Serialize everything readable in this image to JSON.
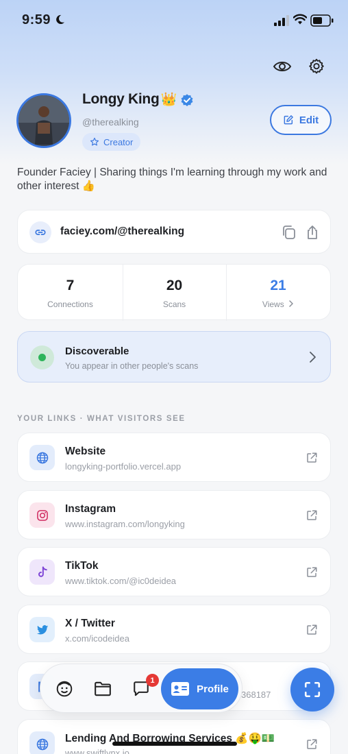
{
  "status": {
    "time": "9:59"
  },
  "profile": {
    "name": "Longy King",
    "name_emoji": "👑",
    "handle": "@therealking",
    "badge": "Creator",
    "edit_label": "Edit",
    "bio": "Founder Faciey | Sharing things I'm learning through my work and other interest 👍"
  },
  "link": {
    "url": "faciey.com/@therealking"
  },
  "stats": [
    {
      "value": "7",
      "label": "Connections"
    },
    {
      "value": "20",
      "label": "Scans"
    },
    {
      "value": "21",
      "label": "Views"
    }
  ],
  "discoverable": {
    "title": "Discoverable",
    "subtitle": "You appear in other people's scans"
  },
  "links_section": {
    "heading": "YOUR LINKS · WHAT VISITORS SEE",
    "items": [
      {
        "title": "Website",
        "url": "longyking-portfolio.vercel.app",
        "icon": "globe-icon"
      },
      {
        "title": "Instagram",
        "url": "www.instagram.com/longyking",
        "icon": "instagram-icon"
      },
      {
        "title": "TikTok",
        "url": "www.tiktok.com/@ic0deidea",
        "icon": "tiktok-icon"
      },
      {
        "title": "X / Twitter",
        "url": "x.com/icodeidea",
        "icon": "twitter-icon"
      },
      {
        "title": "",
        "url": "368187",
        "icon": "card-icon"
      },
      {
        "title": "Lending And Borrowing Services 💰🤑💵",
        "url": "www.swiftlynx.io",
        "icon": "globe-icon"
      }
    ]
  },
  "nav": {
    "badge_count": "1",
    "profile_label": "Profile"
  },
  "colors": {
    "accent": "#3b7de6",
    "green": "#2db45a",
    "badge": "#e53935"
  }
}
